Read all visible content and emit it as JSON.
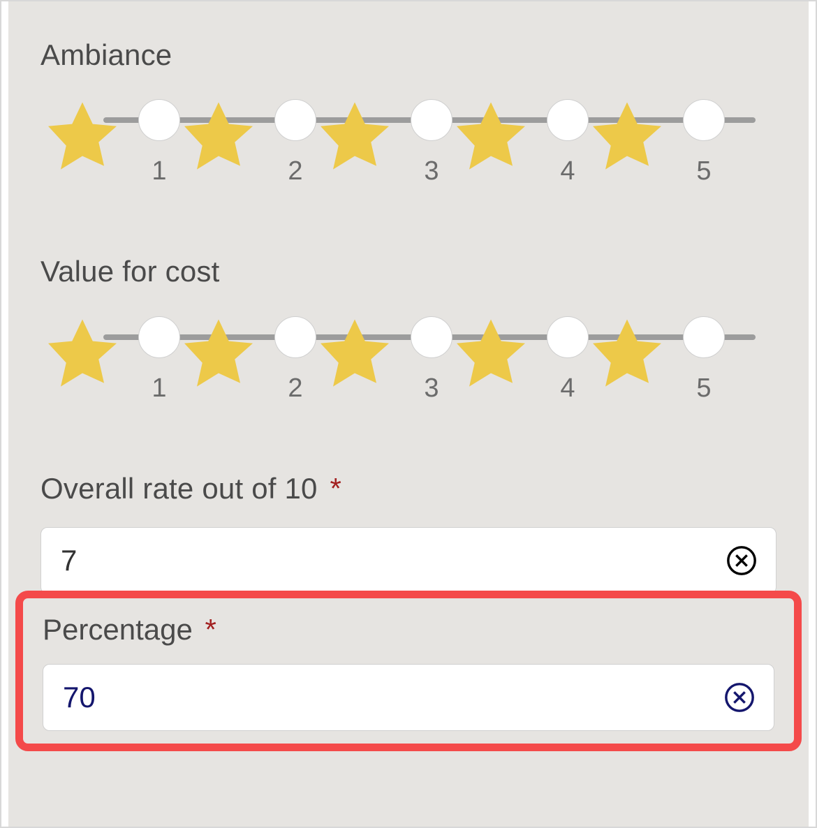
{
  "ratings": {
    "ambiance": {
      "label": "Ambiance",
      "values": [
        "1",
        "2",
        "3",
        "4",
        "5"
      ]
    },
    "value_for_cost": {
      "label": "Value for cost",
      "values": [
        "1",
        "2",
        "3",
        "4",
        "5"
      ]
    }
  },
  "overall": {
    "label": "Overall rate out of 10",
    "required_marker": "*",
    "value": "7"
  },
  "percentage": {
    "label": "Percentage",
    "required_marker": "*",
    "value": "70"
  },
  "colors": {
    "star_fill": "#edc949",
    "highlight_border": "#f44a4a",
    "accent_blue": "#14166d",
    "required": "#a22020"
  },
  "icons": {
    "clear": "circle-x"
  }
}
